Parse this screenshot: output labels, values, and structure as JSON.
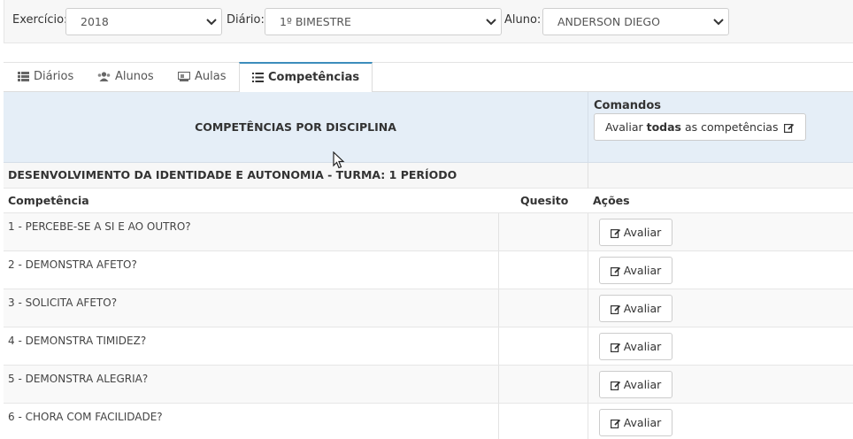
{
  "filters": {
    "exercicio_label": "Exercício:",
    "exercicio_value": "2018",
    "diario_label": "Diário:",
    "diario_value": "1º BIMESTRE",
    "aluno_label": "Aluno:",
    "aluno_value": "ANDERSON DIEGO"
  },
  "tabs": [
    {
      "label": "Diários",
      "icon": "list-icon"
    },
    {
      "label": "Alunos",
      "icon": "users-icon"
    },
    {
      "label": "Aulas",
      "icon": "classroom-icon"
    },
    {
      "label": "Competências",
      "icon": "list-ul-icon",
      "active": true
    }
  ],
  "table": {
    "title": "COMPETÊNCIAS POR DISCIPLINA",
    "commands_label": "Comandos",
    "evaluate_all_prefix": "Avaliar ",
    "evaluate_all_bold": "todas",
    "evaluate_all_suffix": " as competências",
    "section_title": "DESENVOLVIMENTO DA IDENTIDADE E AUTONOMIA - TURMA: 1 PERÍODO",
    "columns": [
      "Competência",
      "Quesito",
      "Ações"
    ],
    "action_label": "Avaliar",
    "rows": [
      "1 - PERCEBE-SE A SI E AO OUTRO?",
      "2 - DEMONSTRA AFETO?",
      "3 - SOLICITA AFETO?",
      "4 - DEMONSTRA TIMIDEZ?",
      "5 - DEMONSTRA ALEGRIA?",
      "6 - CHORA COM FACILIDADE?"
    ]
  },
  "colors": {
    "header_bg": "#e5eef7",
    "active_tab_border": "#3c8dbc"
  }
}
